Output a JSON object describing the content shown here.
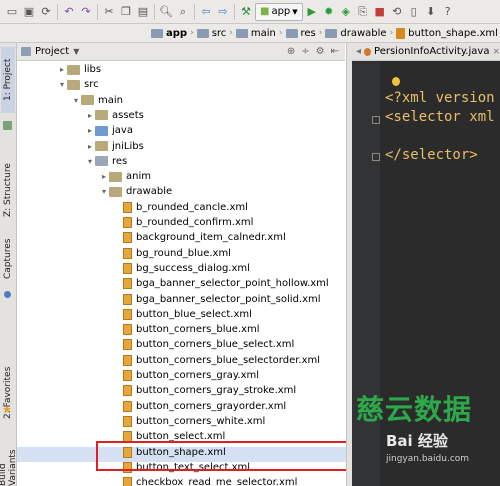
{
  "toolbar": {
    "run_config": "app",
    "icons": [
      "open-icon",
      "save-icon",
      "sync-icon",
      "undo-icon",
      "redo-icon",
      "cut-icon",
      "copy-icon",
      "paste-icon",
      "find-icon",
      "replace-icon",
      "back-icon",
      "forward-icon",
      "build-icon",
      "run-icon",
      "debug-icon",
      "profile-icon",
      "stop-icon",
      "avd-icon",
      "sdk-icon"
    ]
  },
  "breadcrumb": [
    "app",
    "src",
    "main",
    "res",
    "drawable",
    "button_shape.xml"
  ],
  "sidebar_tabs": {
    "project": "1: Project",
    "structure": "Z: Structure",
    "captures": "Captures",
    "favorites": "2: Favorites",
    "build_variants": "Build Variants"
  },
  "panel": {
    "title": "Project"
  },
  "editor_tab": "PersionInfoActivity.java",
  "tree": [
    {
      "label": "libs",
      "kind": "plain",
      "depth": 3,
      "arrow": "▸"
    },
    {
      "label": "src",
      "kind": "plain",
      "depth": 3,
      "arrow": "▾"
    },
    {
      "label": "main",
      "kind": "plain",
      "depth": 4,
      "arrow": "▾"
    },
    {
      "label": "assets",
      "kind": "plain",
      "depth": 5,
      "arrow": "▸"
    },
    {
      "label": "java",
      "kind": "java",
      "depth": 5,
      "arrow": "▸"
    },
    {
      "label": "jniLibs",
      "kind": "plain",
      "depth": 5,
      "arrow": "▸"
    },
    {
      "label": "res",
      "kind": "res",
      "depth": 5,
      "arrow": "▾"
    },
    {
      "label": "anim",
      "kind": "plain",
      "depth": 6,
      "arrow": "▸"
    },
    {
      "label": "drawable",
      "kind": "plain",
      "depth": 6,
      "arrow": "▾"
    },
    {
      "label": "b_rounded_cancle.xml",
      "kind": "file",
      "depth": 7
    },
    {
      "label": "b_rounded_confirm.xml",
      "kind": "file",
      "depth": 7
    },
    {
      "label": "background_item_calnedr.xml",
      "kind": "file",
      "depth": 7
    },
    {
      "label": "bg_round_blue.xml",
      "kind": "file",
      "depth": 7
    },
    {
      "label": "bg_success_dialog.xml",
      "kind": "file",
      "depth": 7
    },
    {
      "label": "bga_banner_selector_point_hollow.xml",
      "kind": "file",
      "depth": 7
    },
    {
      "label": "bga_banner_selector_point_solid.xml",
      "kind": "file",
      "depth": 7
    },
    {
      "label": "button_blue_select.xml",
      "kind": "file",
      "depth": 7
    },
    {
      "label": "button_corners_blue.xml",
      "kind": "file",
      "depth": 7
    },
    {
      "label": "button_corners_blue_select.xml",
      "kind": "file",
      "depth": 7
    },
    {
      "label": "button_corners_blue_selectorder.xml",
      "kind": "file",
      "depth": 7
    },
    {
      "label": "button_corners_gray.xml",
      "kind": "file",
      "depth": 7
    },
    {
      "label": "button_corners_gray_stroke.xml",
      "kind": "file",
      "depth": 7
    },
    {
      "label": "button_corners_grayorder.xml",
      "kind": "file",
      "depth": 7
    },
    {
      "label": "button_corners_white.xml",
      "kind": "file",
      "depth": 7
    },
    {
      "label": "button_select.xml",
      "kind": "file",
      "depth": 7
    },
    {
      "label": "button_shape.xml",
      "kind": "file",
      "depth": 7,
      "selected": true
    },
    {
      "label": "button_text_select.xml",
      "kind": "file",
      "depth": 7
    },
    {
      "label": "checkbox_read_me_selector.xml",
      "kind": "file",
      "depth": 7
    }
  ],
  "code_lines": [
    "<?xml version",
    "<selector xml",
    "",
    "</selector>"
  ],
  "watermark": {
    "text1": "慈云数据",
    "text2": "Bai 经验",
    "text3": "jingyan.baidu.com"
  }
}
